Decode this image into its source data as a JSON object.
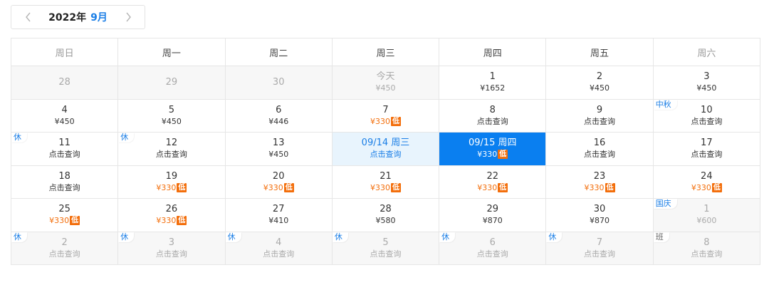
{
  "header": {
    "year": "2022年",
    "month": "9月"
  },
  "weekdays": [
    "周日",
    "周一",
    "周二",
    "周三",
    "周四",
    "周五",
    "周六"
  ],
  "low_label": "低",
  "weeks": [
    [
      {
        "day": "28",
        "info": "",
        "state": "dim"
      },
      {
        "day": "29",
        "info": "",
        "state": "dim"
      },
      {
        "day": "30",
        "info": "",
        "state": "dim"
      },
      {
        "day": "今天",
        "info": "¥450",
        "state": "dim"
      },
      {
        "day": "1",
        "info": "¥1652"
      },
      {
        "day": "2",
        "info": "¥450"
      },
      {
        "day": "3",
        "info": "¥450"
      }
    ],
    [
      {
        "day": "4",
        "info": "¥450"
      },
      {
        "day": "5",
        "info": "¥450"
      },
      {
        "day": "6",
        "info": "¥446"
      },
      {
        "day": "7",
        "info": "¥330",
        "low": true
      },
      {
        "day": "8",
        "info": "点击查询"
      },
      {
        "day": "9",
        "info": "点击查询"
      },
      {
        "day": "10",
        "info": "点击查询",
        "tag": "中秋"
      }
    ],
    [
      {
        "day": "11",
        "info": "点击查询",
        "tag": "休"
      },
      {
        "day": "12",
        "info": "点击查询",
        "tag": "休"
      },
      {
        "day": "13",
        "info": "¥450"
      },
      {
        "day": "09/14 周三",
        "info": "点击查询",
        "state": "range"
      },
      {
        "day": "09/15 周四",
        "info": "¥330",
        "low": true,
        "state": "selected"
      },
      {
        "day": "16",
        "info": "点击查询"
      },
      {
        "day": "17",
        "info": "点击查询"
      }
    ],
    [
      {
        "day": "18",
        "info": "点击查询"
      },
      {
        "day": "19",
        "info": "¥330",
        "low": true
      },
      {
        "day": "20",
        "info": "¥330",
        "low": true
      },
      {
        "day": "21",
        "info": "¥330",
        "low": true
      },
      {
        "day": "22",
        "info": "¥330",
        "low": true
      },
      {
        "day": "23",
        "info": "¥330",
        "low": true
      },
      {
        "day": "24",
        "info": "¥330",
        "low": true
      }
    ],
    [
      {
        "day": "25",
        "info": "¥330",
        "low": true
      },
      {
        "day": "26",
        "info": "¥330",
        "low": true
      },
      {
        "day": "27",
        "info": "¥410"
      },
      {
        "day": "28",
        "info": "¥580"
      },
      {
        "day": "29",
        "info": "¥870"
      },
      {
        "day": "30",
        "info": "¥870"
      },
      {
        "day": "1",
        "info": "¥600",
        "state": "dim",
        "tag": "国庆"
      }
    ],
    [
      {
        "day": "2",
        "info": "点击查询",
        "state": "dim",
        "tag": "休"
      },
      {
        "day": "3",
        "info": "点击查询",
        "state": "dim",
        "tag": "休"
      },
      {
        "day": "4",
        "info": "点击查询",
        "state": "dim",
        "tag": "休"
      },
      {
        "day": "5",
        "info": "点击查询",
        "state": "dim",
        "tag": "休"
      },
      {
        "day": "6",
        "info": "点击查询",
        "state": "dim",
        "tag": "休"
      },
      {
        "day": "7",
        "info": "点击查询",
        "state": "dim",
        "tag": "休"
      },
      {
        "day": "8",
        "info": "点击查询",
        "state": "dim",
        "tag": "班",
        "tag_kind": "work"
      }
    ]
  ],
  "colors": {
    "accent": "#0a7ff0",
    "low": "#f36e0b",
    "range": "#e8f4fd"
  },
  "icons": {
    "prev": "chevron-left-icon",
    "next": "chevron-right-icon"
  }
}
